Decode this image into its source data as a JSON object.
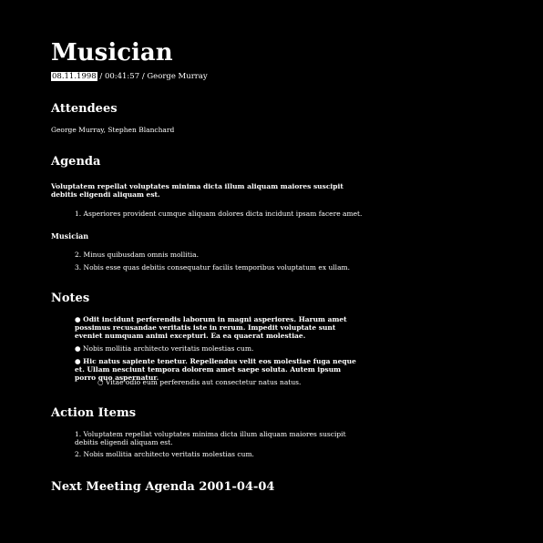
{
  "title": "Musician",
  "meta": {
    "date": "08.11.1998",
    "rest": " / 00:41:57 / George Murray"
  },
  "attendees": {
    "heading": "Attendees",
    "text": "George Murray, Stephen Blanchard"
  },
  "agenda": {
    "heading": "Agenda",
    "intro": "Voluptatem repellat voluptates minima dicta illum aliquam maiores suscipit debitis eligendi aliquam est.",
    "item1": "1. Asperiores provident cumque aliquam dolores dicta incidunt ipsam facere amet.",
    "subheading": "Musician",
    "item2": "2. Minus quibusdam omnis mollitia.",
    "item3": "3. Nobis esse quas debitis consequatur facilis temporibus voluptatum ex ullam."
  },
  "notes": {
    "heading": "Notes",
    "b1": "● Odit incidunt perferendis laborum in magni asperiores. Harum amet possimus recusandae veritatis iste in rerum. Impedit voluptate sunt eveniet numquam animi excepturi. Ea ea quaerat molestiae.",
    "b2": "● Nobis mollitia architecto veritatis molestias cum.",
    "b3": "● Hic natus sapiente tenetur. Repellendus velit eos molestiae fuga neque et. Ullam nesciunt tempora dolorem amet saepe soluta. Autem ipsum porro quo aspernatur.",
    "b3sub": "○ Vitae odio eum perferendis aut consectetur natus natus."
  },
  "action_items": {
    "heading": "Action Items",
    "item1": "1. Voluptatem repellat voluptates minima dicta illum aliquam maiores suscipit debitis eligendi aliquam est.",
    "item2": "2. Nobis mollitia architecto veritatis molestias cum."
  },
  "next_meeting": {
    "heading": "Next Meeting Agenda 2001-04-04"
  }
}
